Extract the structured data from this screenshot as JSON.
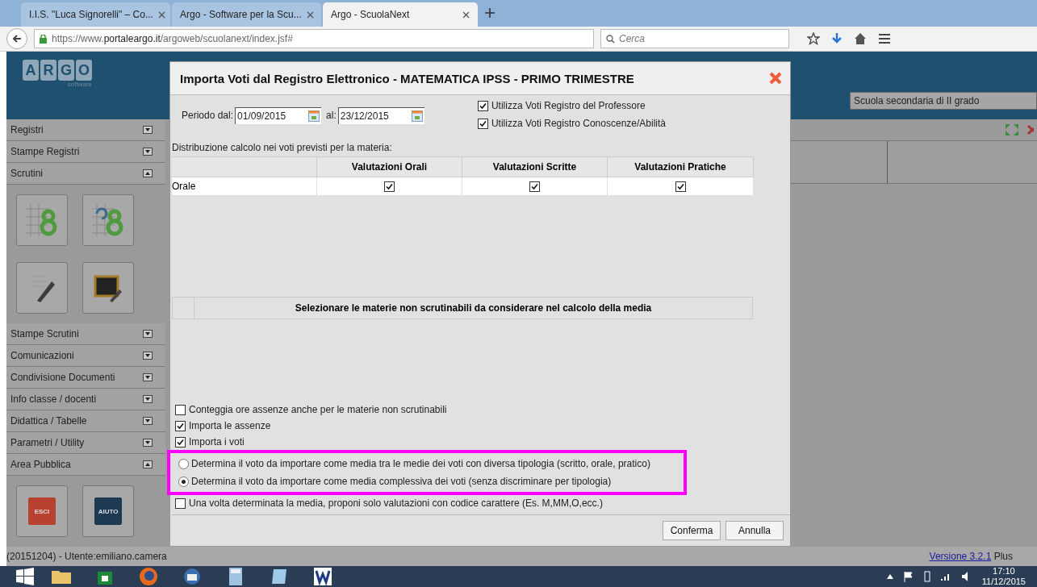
{
  "browser": {
    "tabs": [
      {
        "label": "I.I.S. \"Luca Signorelli\" – Co...",
        "selected": false
      },
      {
        "label": "Argo - Software per la Scu...",
        "selected": false
      },
      {
        "label": "Argo - ScuolaNext",
        "selected": true
      }
    ],
    "url_prefix": "https://www.",
    "url_domain": "portaleargo.it",
    "url_path": "/argoweb/scuolanext/index.jsf#",
    "search_placeholder": "Cerca"
  },
  "header": {
    "logo_letters": [
      "A",
      "R",
      "G",
      "O"
    ],
    "logo_sub": "software",
    "school_select": "Scuola secondaria di II grado"
  },
  "sidebar": [
    {
      "label": "Registri",
      "expanded": false,
      "kind": "plain"
    },
    {
      "label": "Stampe Registri",
      "expanded": false,
      "kind": "plain"
    },
    {
      "label": "Scrutini",
      "expanded": true,
      "kind": "grades"
    },
    {
      "label": "Stampe Scrutini",
      "expanded": false,
      "kind": "plain"
    },
    {
      "label": "Comunicazioni",
      "expanded": false,
      "kind": "plain"
    },
    {
      "label": "Condivisione Documenti",
      "expanded": false,
      "kind": "plain"
    },
    {
      "label": "Info classe / docenti",
      "expanded": false,
      "kind": "plain"
    },
    {
      "label": "Didattica / Tabelle",
      "expanded": false,
      "kind": "plain"
    },
    {
      "label": "Parametri / Utility",
      "expanded": false,
      "kind": "plain"
    },
    {
      "label": "Area Pubblica",
      "expanded": true,
      "kind": "public"
    }
  ],
  "public_tiles": [
    {
      "label": "ESCI",
      "color": "#b8412f"
    },
    {
      "label": "AIUTO",
      "color": "#1d3a52"
    }
  ],
  "status_bar": {
    "user": "(20151204) - Utente:emiliano.camera",
    "version_link": "Versione 3.2.1",
    "edition": "Plus"
  },
  "dialog": {
    "title": "Importa Voti dal Registro Elettronico - MATEMATICA IPSS - PRIMO TRIMESTRE",
    "period_from_label": "Periodo dal:",
    "period_from": "01/09/2015",
    "period_to_label": "al:",
    "period_to": "23/12/2015",
    "sources": [
      {
        "label": "Utilizza Voti Registro del Professore",
        "checked": true
      },
      {
        "label": "Utilizza Voti Registro Conoscenze/Abilità",
        "checked": true
      }
    ],
    "distribution_label": "Distribuzione calcolo nei voti previsti per la materia:",
    "columns": [
      "Valutazioni Orali",
      "Valutazioni Scritte",
      "Valutazioni Pratiche"
    ],
    "rows": [
      {
        "label": "Orale",
        "checks": [
          true,
          true,
          true
        ]
      }
    ],
    "subjects_header": "Selezionare le materie non scrutinabili da considerare nel calcolo della media",
    "options": [
      {
        "kind": "checkbox",
        "label": "Conteggia ore assenze anche per le materie non scrutinabili",
        "checked": false
      },
      {
        "kind": "checkbox",
        "label": "Importa le assenze",
        "checked": true
      },
      {
        "kind": "checkbox",
        "label": "Importa i voti",
        "checked": true
      },
      {
        "kind": "radio",
        "label": "Determina il voto da importare come media tra le medie dei voti con diversa tipologia (scritto, orale, pratico)",
        "selected": false
      },
      {
        "kind": "radio",
        "label": "Determina il voto da importare come media complessiva dei voti (senza discriminare per tipologia)",
        "selected": true
      },
      {
        "kind": "checkbox",
        "label": "Una volta determinata la media, proponi solo valutazioni con codice carattere (Es. M,MM,O,ecc.)",
        "checked": false
      }
    ],
    "buttons": [
      "Conferma",
      "Annulla"
    ]
  },
  "taskbar": {
    "time": "17:10",
    "date": "11/12/2015"
  }
}
